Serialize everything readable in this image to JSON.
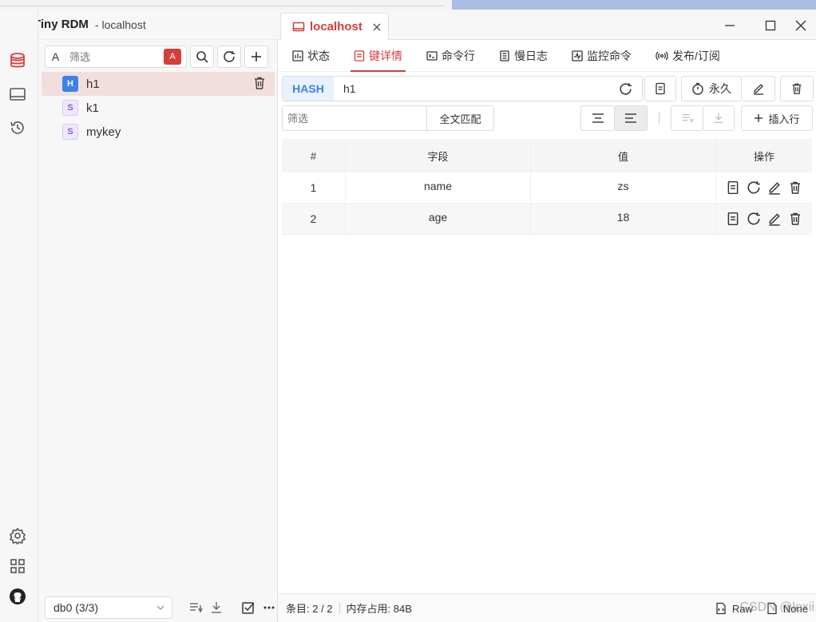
{
  "app": {
    "name": "Tiny RDM",
    "host": " - localhost"
  },
  "left": {
    "filter_prefix": "A",
    "filter_placeholder": "筛选",
    "case_label": "A",
    "keys": [
      {
        "type": "H",
        "name": "h1",
        "selected": true
      },
      {
        "type": "S",
        "name": "k1",
        "selected": false
      },
      {
        "type": "S",
        "name": "mykey",
        "selected": false
      }
    ],
    "db_select": "db0 (3/3)"
  },
  "conn_tab": {
    "label": "localhost"
  },
  "subtabs": [
    {
      "label": "状态",
      "icon": "status-chart-icon",
      "active": false
    },
    {
      "label": "键详情",
      "icon": "key-detail-icon",
      "active": true
    },
    {
      "label": "命令行",
      "icon": "terminal-icon",
      "active": false
    },
    {
      "label": "慢日志",
      "icon": "log-icon",
      "active": false
    },
    {
      "label": "监控命令",
      "icon": "monitor-icon",
      "active": false
    },
    {
      "label": "发布/订阅",
      "icon": "broadcast-icon",
      "active": false
    }
  ],
  "key": {
    "type": "HASH",
    "name": "h1",
    "ttl_label": "永久"
  },
  "toolbar": {
    "filter_placeholder": "筛选",
    "fulltext_label": "全文匹配",
    "insert_label": "插入行"
  },
  "table": {
    "headers": [
      "#",
      "字段",
      "值",
      "操作"
    ],
    "rows": [
      {
        "index": "1",
        "field": "name",
        "value": "zs"
      },
      {
        "index": "2",
        "field": "age",
        "value": "18"
      }
    ]
  },
  "status": {
    "count": "条目: 2 / 2",
    "memory": "内存占用: 84B",
    "raw_label": "Raw",
    "none_label": "None",
    "watermark": "CSDN @lexii"
  },
  "colors": {
    "accent": "#d43f3a",
    "hash_badge": "#3b82e8",
    "string_badge": "#8a5ad8"
  }
}
